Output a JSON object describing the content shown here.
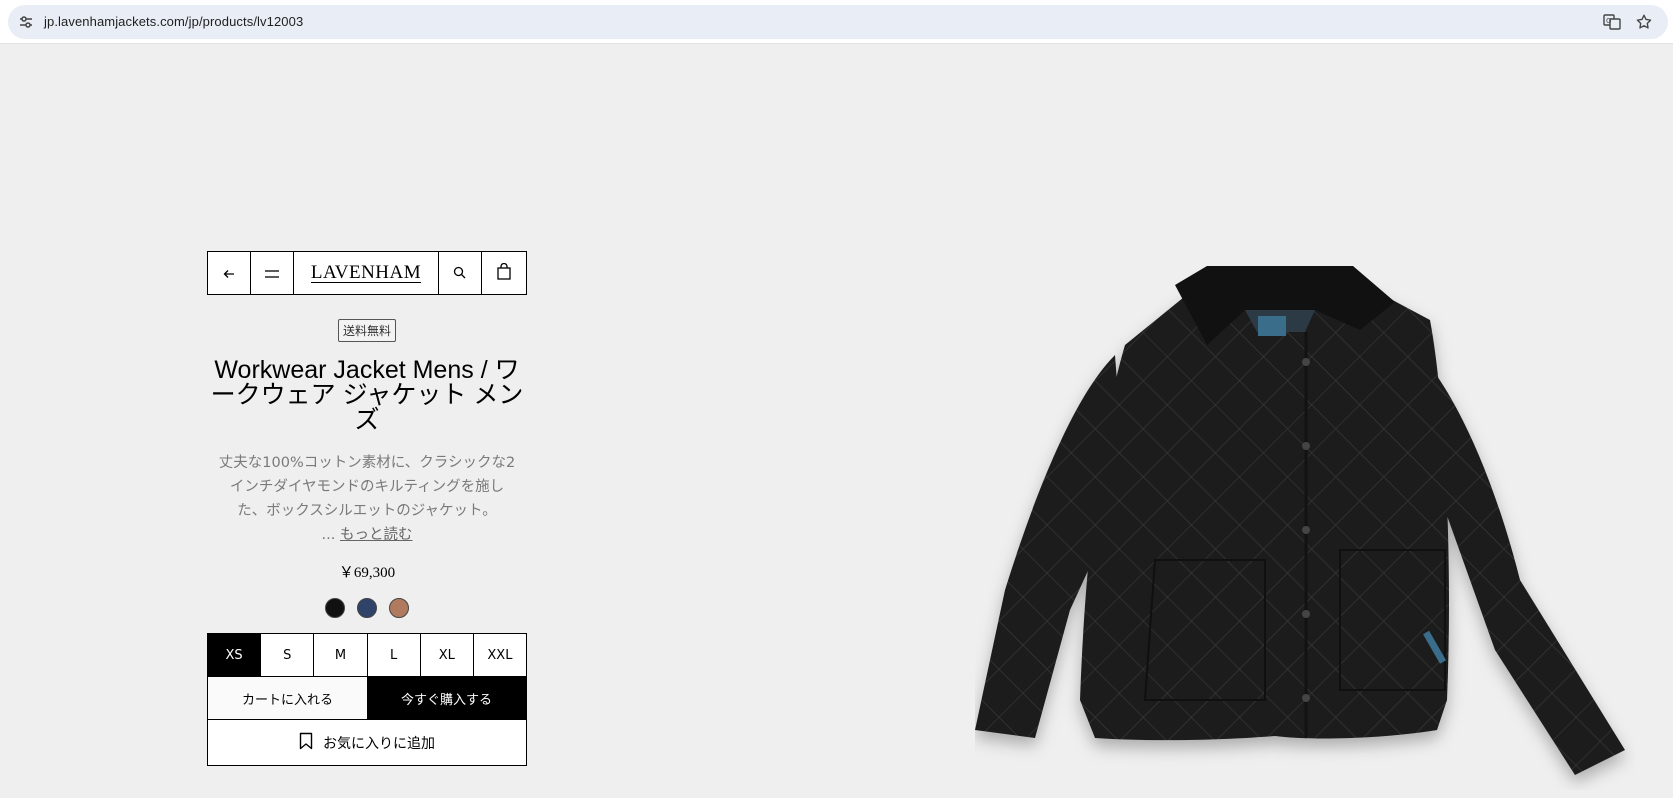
{
  "browser": {
    "url": "jp.lavenhamjackets.com/jp/products/lv12003",
    "icons": [
      "site-info-icon",
      "translate-icon",
      "bookmark-star-icon"
    ]
  },
  "nav": {
    "back_icon": "arrow-left-icon",
    "menu_icon": "menu-icon",
    "logo": "LAVENHAM",
    "search_icon": "search-icon",
    "cart_icon": "shopping-bag-icon"
  },
  "product": {
    "badge": "送料無料",
    "title": "Workwear Jacket Mens / ワークウェア ジャケット メンズ",
    "description_line1": "丈夫な100%コットン素材に、クラシックな2",
    "description_line2": "インチダイヤモンドのキルティングを施し",
    "description_line3": "た、ボックスシルエットのジャケット。",
    "ellipsis": "... ",
    "read_more": "もっと読む",
    "price": "￥69,300",
    "colors": [
      "#111111",
      "#2f4368",
      "#b07a5e"
    ],
    "sizes": [
      "XS",
      "S",
      "M",
      "L",
      "XL",
      "XXL"
    ],
    "selected_size": "XS",
    "add_to_cart": "カートに入れる",
    "buy_now": "今すぐ購入する",
    "wishlist": "お気に入りに追加"
  }
}
